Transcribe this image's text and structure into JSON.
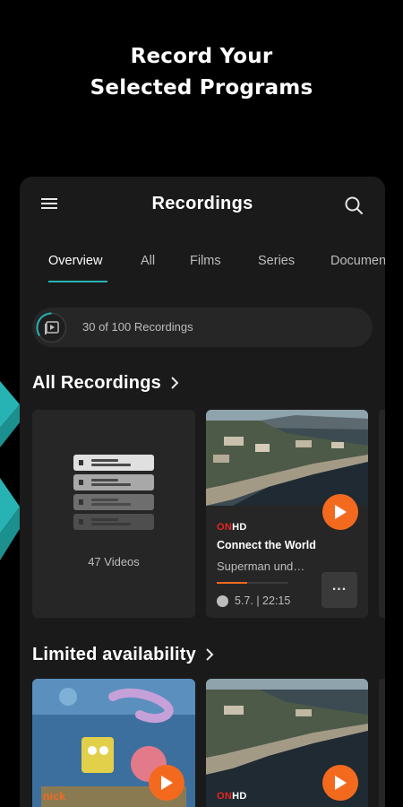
{
  "headline": {
    "line1": "Record Your",
    "line2": "Selected Programs"
  },
  "app": {
    "title": "Recordings",
    "tabs": [
      {
        "label": "Overview",
        "active": true
      },
      {
        "label": "All"
      },
      {
        "label": "Films"
      },
      {
        "label": "Series"
      },
      {
        "label": "Documen"
      }
    ],
    "counter": {
      "text": "30 of 100 Recordings"
    },
    "sections": {
      "all_recordings": {
        "title": "All Recordings",
        "folder": {
          "caption": "47 Videos"
        },
        "program": {
          "channel": {
            "part1": "ON",
            "part2": "HD"
          },
          "title": "Connect the World",
          "subtitle": "Superman und…",
          "datetime": "5.7. | 22:15",
          "progress": 0.42
        }
      },
      "limited": {
        "title": "Limited availability",
        "cards": [
          {
            "channel": "nick"
          },
          {
            "channel": {
              "part1": "ON",
              "part2": "HD"
            }
          }
        ]
      }
    }
  },
  "colors": {
    "accent": "#27b3b3",
    "play": "#f36a1f",
    "background": "#000000",
    "panel": "#1a1a1a",
    "card": "#262626"
  },
  "icons": [
    "menu-icon",
    "search-icon",
    "recordings-icon",
    "chevron-right-icon",
    "play-icon",
    "clock-icon",
    "more-icon"
  ]
}
